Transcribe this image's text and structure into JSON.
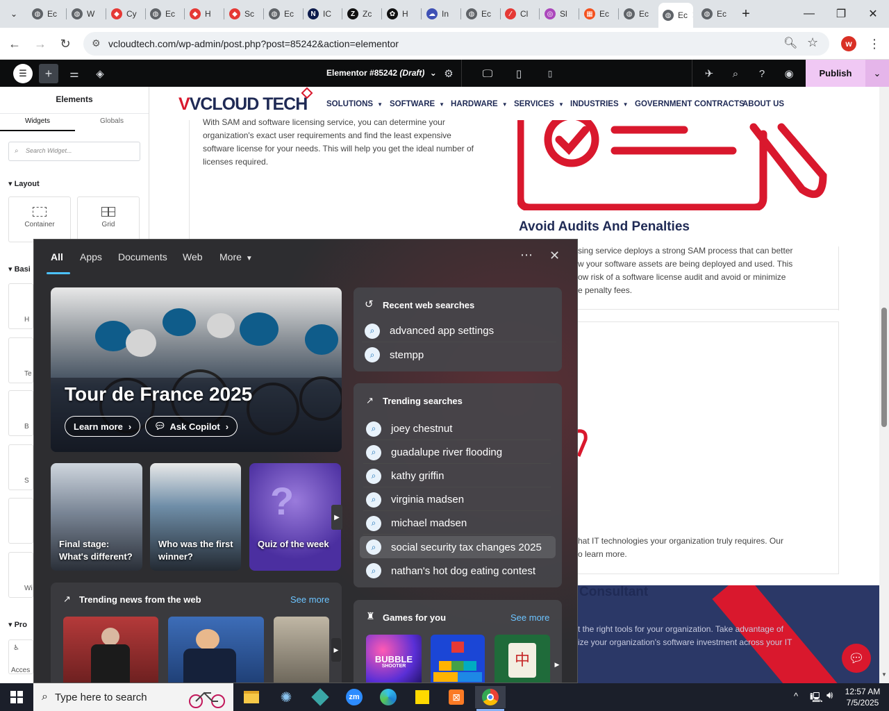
{
  "browser": {
    "tabs": [
      {
        "label": "Ec",
        "icon": "globe-icon",
        "color": "#5f6368"
      },
      {
        "label": "W",
        "icon": "globe-icon",
        "color": "#5f6368"
      },
      {
        "label": "Cy",
        "icon": "diamond-icon",
        "color": "#e53935"
      },
      {
        "label": "Ec",
        "icon": "globe-icon",
        "color": "#5f6368"
      },
      {
        "label": "H",
        "icon": "diamond-icon",
        "color": "#e53935"
      },
      {
        "label": "Sc",
        "icon": "diamond-icon",
        "color": "#e53935"
      },
      {
        "label": "Ec",
        "icon": "globe-icon",
        "color": "#5f6368"
      },
      {
        "label": "IC",
        "icon": "n-icon",
        "color": "#0d1b4c"
      },
      {
        "label": "Zc",
        "icon": "z-icon",
        "color": "#111111"
      },
      {
        "label": "H",
        "icon": "openai-icon",
        "color": "#111111"
      },
      {
        "label": "In",
        "icon": "cloud-icon",
        "color": "#3f51b5"
      },
      {
        "label": "Ec",
        "icon": "globe-icon",
        "color": "#5f6368"
      },
      {
        "label": "Cl",
        "icon": "slash-icon",
        "color": "#e53935"
      },
      {
        "label": "Sl",
        "icon": "ring-icon",
        "color": "#ab47bc"
      },
      {
        "label": "Ec",
        "icon": "grid-icon",
        "color": "#f4511e"
      },
      {
        "label": "Ec",
        "icon": "globe-icon",
        "color": "#5f6368"
      },
      {
        "label": "Ec",
        "icon": "globe-icon",
        "color": "#5f6368",
        "active": true
      },
      {
        "label": "Ec",
        "icon": "globe-icon",
        "color": "#5f6368"
      }
    ],
    "url": "vcloudtech.com/wp-admin/post.php?post=85242&action=elementor",
    "profile_initial": "w"
  },
  "elementor": {
    "doc_title": "Elementor #85242",
    "doc_status": "(Draft)",
    "publish_label": "Publish",
    "panel": {
      "title": "Elements",
      "tab_widgets": "Widgets",
      "tab_globals": "Globals",
      "search_placeholder": "Search Widget...",
      "section_layout": "Layout",
      "widget_container": "Container",
      "widget_grid": "Grid",
      "section_basic": "Basi",
      "section_pro": "Pro",
      "partial_left_labels": [
        "H",
        "Te",
        "B",
        "S",
        "",
        "Wi"
      ],
      "bottom_label": "Acces"
    }
  },
  "site": {
    "logo_text": "VCLOUD TECH",
    "nav": [
      "SOLUTIONS",
      "SOFTWARE",
      "HARDWARE",
      "SERVICES",
      "INDUSTRIES",
      "GOVERNMENT CONTRACTS",
      "ABOUT US"
    ],
    "left_text": [
      "With SAM and software licensing service, you can determine your",
      "organization's exact user requirements and find the least expensive",
      "software license for your needs. This will help you get the ideal number of",
      "licenses required."
    ],
    "heading_audits": "Avoid Audits And Penalties",
    "right_text": [
      "sing service deploys a strong SAM process that can better",
      "w your software assets are being deployed and used. This",
      "ow risk of a software license audit and avoid or minimize",
      "e penalty fees."
    ],
    "right_text2": [
      "hat IT technologies your organization truly requires. Our",
      "o learn more."
    ],
    "consultant_heading": "Consultant",
    "consultant_text": [
      "t the right tools for your organization. Take advantage of",
      "ize your organization's software investment across your IT"
    ]
  },
  "search_flyout": {
    "tabs": [
      "All",
      "Apps",
      "Documents",
      "Web",
      "More"
    ],
    "hero": {
      "title": "Tour de France 2025",
      "learn_more": "Learn more",
      "ask_copilot": "Ask Copilot"
    },
    "tiles": [
      {
        "line1": "Final stage:",
        "line2": "What's different?"
      },
      {
        "line1": "Who was the first",
        "line2": "winner?"
      },
      {
        "line1": "",
        "line2": "Quiz of the week"
      }
    ],
    "trending_news": {
      "title": "Trending news from the web",
      "see_more": "See more"
    },
    "recent": {
      "title": "Recent web searches",
      "items": [
        "advanced app settings",
        "stempp"
      ]
    },
    "trending": {
      "title": "Trending searches",
      "items": [
        "joey chestnut",
        "guadalupe river flooding",
        "kathy griffin",
        "virginia madsen",
        "michael madsen",
        "social security tax changes 2025",
        "nathan's hot dog eating contest"
      ],
      "highlighted_index": 5
    },
    "games": {
      "title": "Games for you",
      "see_more": "See more",
      "bubble_text": "BUBBLE",
      "bubble_sub": "SHOOTER"
    }
  },
  "taskbar": {
    "search_placeholder": "Type here to search",
    "time": "12:57 AM",
    "date": "7/5/2025"
  },
  "colors": {
    "brand_red": "#d9182d",
    "brand_navy": "#1f2a55",
    "publish_bg": "#f0c8f4",
    "flyout_bg": "#2d2d30"
  }
}
